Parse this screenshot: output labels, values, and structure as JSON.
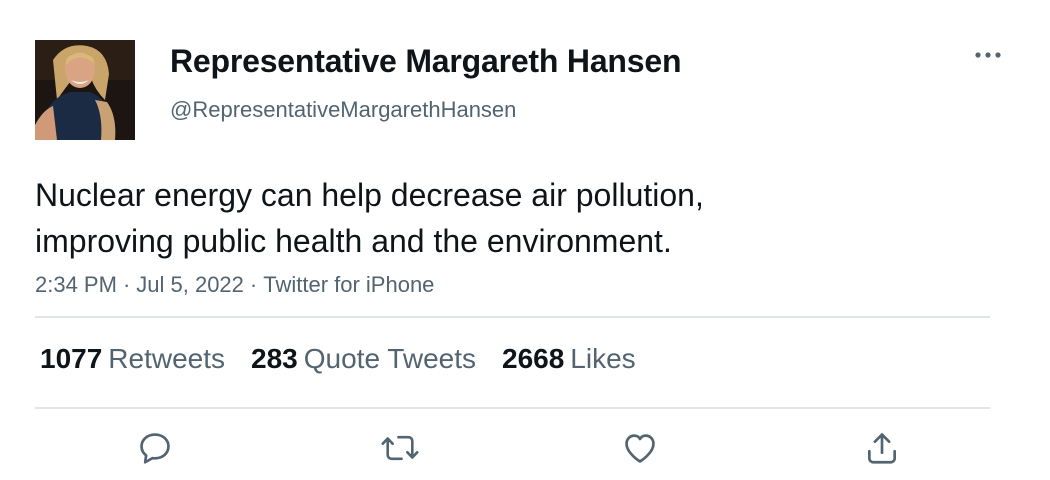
{
  "tweet": {
    "author": {
      "display_name": "Representative Margareth Hansen",
      "handle": "@RepresentativeMargarethHansen"
    },
    "text_lines": [
      "Nuclear energy can help decrease air pollution,",
      "improving public health and the environment."
    ],
    "meta": {
      "time": "2:34 PM",
      "separator": "·",
      "date": "Jul 5, 2022",
      "source": "Twitter for iPhone"
    },
    "stats": {
      "retweets": {
        "count": "1077",
        "label": "Retweets"
      },
      "quote_tweets": {
        "count": "283",
        "label": "Quote Tweets"
      },
      "likes": {
        "count": "2668",
        "label": "Likes"
      }
    },
    "actions": [
      "reply-icon",
      "retweet-icon",
      "like-icon",
      "share-icon"
    ],
    "more_icon": "more-icon"
  },
  "colors": {
    "text_primary": "#0f1419",
    "text_secondary": "#536471",
    "icon": "#536471",
    "divider": "#e1e5e8"
  }
}
